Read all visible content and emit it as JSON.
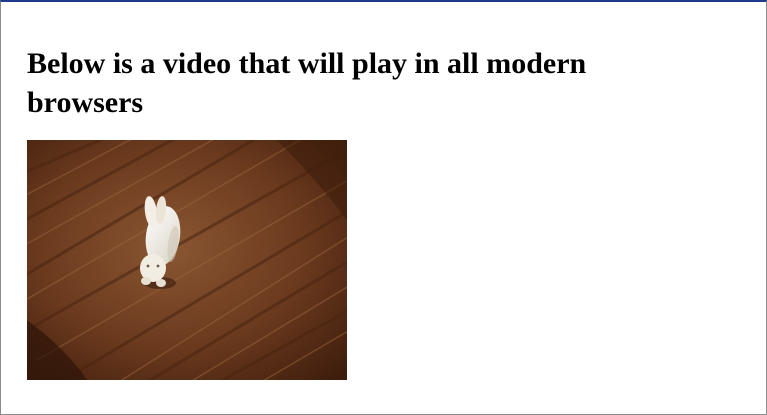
{
  "page": {
    "heading": "Below is a video that will play in all modern browsers"
  },
  "video": {
    "subject": "white rabbit figurine on a wooden table",
    "colors": {
      "wood_dark": "#4a2410",
      "wood_mid": "#6b3a1e",
      "wood_light": "#8a5632",
      "figurine": "#f1ece2"
    }
  },
  "theme": {
    "frame_accent": "#1f3a8a",
    "text": "#000000",
    "background": "#ffffff"
  }
}
